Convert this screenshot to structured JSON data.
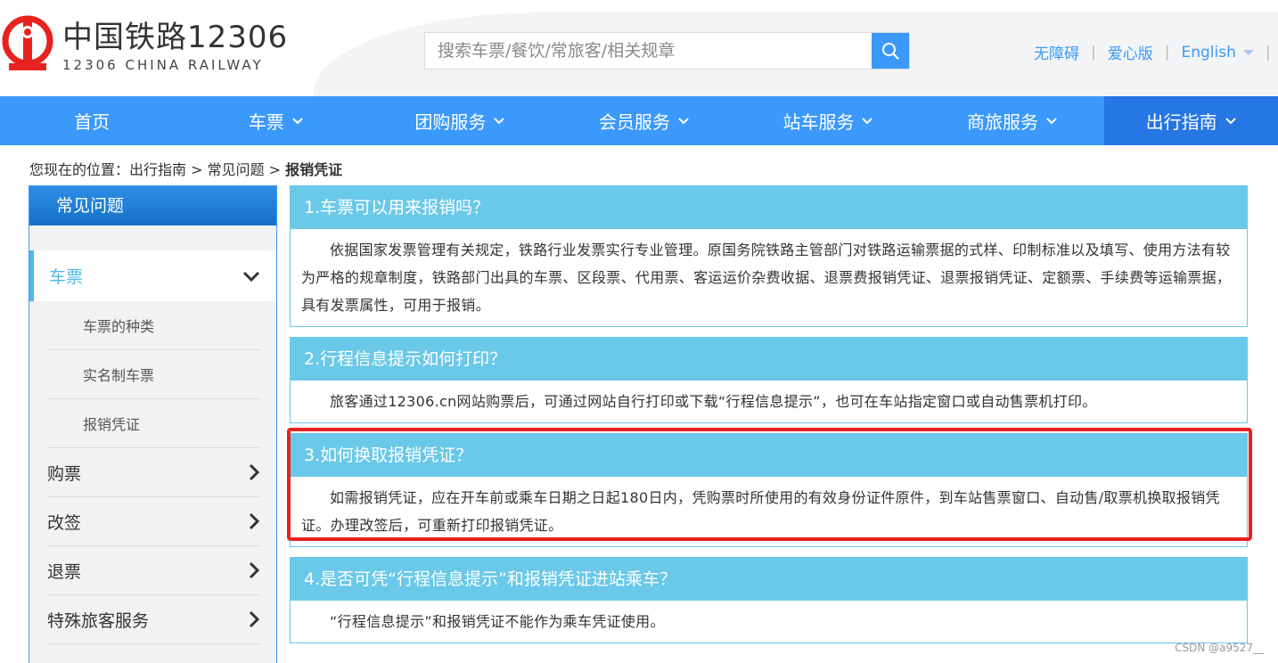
{
  "header": {
    "brand_cn": "中国铁路12306",
    "brand_en": "12306 CHINA RAILWAY",
    "search_placeholder": "搜索车票/餐饮/常旅客/相关规章",
    "links": [
      "无障碍",
      "爱心版",
      "English"
    ]
  },
  "nav": {
    "items": [
      {
        "label": "首页"
      },
      {
        "label": "车票"
      },
      {
        "label": "团购服务"
      },
      {
        "label": "会员服务"
      },
      {
        "label": "站车服务"
      },
      {
        "label": "商旅服务"
      },
      {
        "label": "出行指南"
      }
    ],
    "active": "出行指南"
  },
  "breadcrumb": {
    "prefix": "您现在的位置：出行指南 > 常见问题 > ",
    "current": "报销凭证"
  },
  "sidebar": {
    "title": "常见问题",
    "active_item": "车票",
    "sub_items": [
      "车票的种类",
      "实名制车票",
      "报销凭证"
    ],
    "items": [
      "购票",
      "改签",
      "退票",
      "特殊旅客服务"
    ]
  },
  "qa": [
    {
      "title": "1.车票可以用来报销吗？",
      "body": "依据国家发票管理有关规定，铁路行业发票实行专业管理。原国务院铁路主管部门对铁路运输票据的式样、印制标准以及填写、使用方法有较为严格的规章制度，铁路部门出具的车票、区段票、代用票、客运运价杂费收据、退票费报销凭证、退票报销凭证、定额票、手续费等运输票据，具有发票属性，可用于报销。"
    },
    {
      "title": "2.行程信息提示如何打印？",
      "body": "旅客通过12306.cn网站购票后，可通过网站自行打印或下载“行程信息提示”，也可在车站指定窗口或自动售票机打印。"
    },
    {
      "title": "3.如何换取报销凭证？",
      "body": "如需报销凭证，应在开车前或乘车日期之日起180日内，凭购票时所使用的有效身份证件原件，到车站售票窗口、自动售/取票机换取报销凭证。办理改签后，可重新打印报销凭证。"
    },
    {
      "title": "4.是否可凭“行程信息提示”和报销凭证进站乘车？",
      "body": "“行程信息提示”和报销凭证不能作为乘车凭证使用。"
    }
  ],
  "watermark": "CSDN @a9527__",
  "colors": {
    "primary_blue": "#3b99fc",
    "nav_active": "#2676e3",
    "qa_title_bg": "#6ac8e8",
    "highlight_red": "#e8231f",
    "logo_red": "#e8231f"
  }
}
